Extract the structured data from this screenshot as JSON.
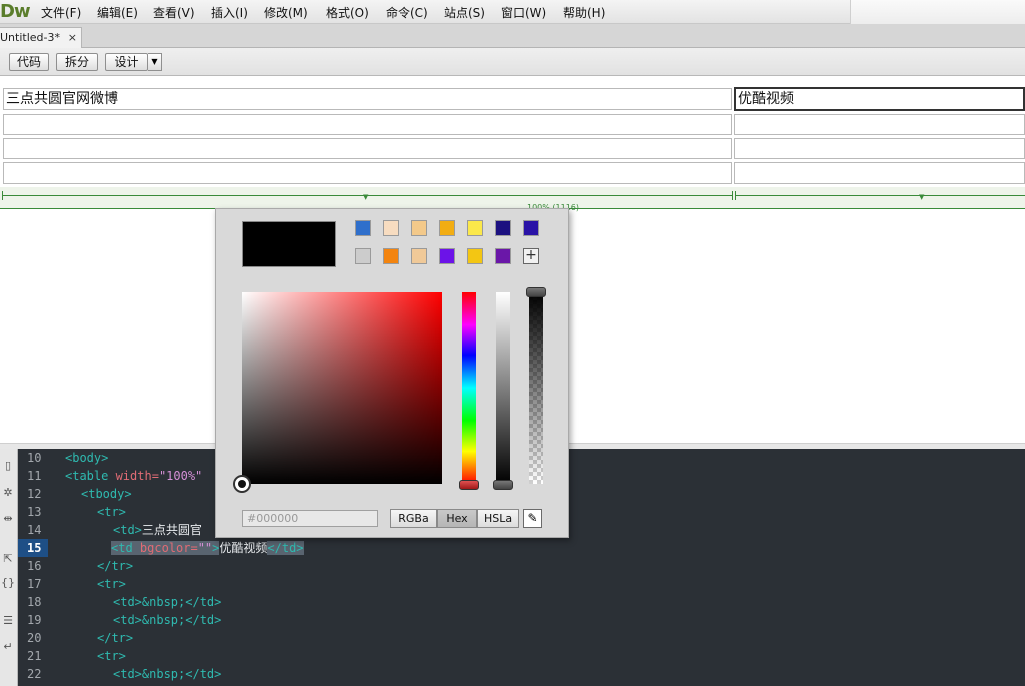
{
  "app": {
    "logo": "Dw"
  },
  "menu": [
    {
      "label": "文件(F)"
    },
    {
      "label": "编辑(E)"
    },
    {
      "label": "查看(V)"
    },
    {
      "label": "插入(I)"
    },
    {
      "label": "修改(M)"
    },
    {
      "label": "格式(O)"
    },
    {
      "label": "命令(C)"
    },
    {
      "label": "站点(S)"
    },
    {
      "label": "窗口(W)"
    },
    {
      "label": "帮助(H)"
    }
  ],
  "tab": {
    "title": "Untitled-3*",
    "close": "×"
  },
  "view_buttons": {
    "code": "代码",
    "split": "拆分",
    "design": "设计",
    "dropdown": "▼"
  },
  "design_table": {
    "cells": [
      [
        "三点共圆官网微博",
        "优酷视频"
      ],
      [
        "",
        ""
      ],
      [
        "",
        ""
      ],
      [
        "",
        ""
      ]
    ],
    "width_label": "100% (1116)"
  },
  "color_picker": {
    "current_color": "#000000",
    "swatches_row1": [
      "#2f6fcb",
      "#f7dcc0",
      "#f3c98a",
      "#f2ad12",
      "#fbe84a",
      "#1c1180",
      "#2a13a6"
    ],
    "swatches_row2": [
      "#cccccc",
      "#f3840f",
      "#f0c998",
      "#6c13e8",
      "#f3c613",
      "#6a17a8"
    ],
    "add_swatch": "+",
    "hex_value": "#000000",
    "modes": [
      {
        "label": "RGBa"
      },
      {
        "label": "Hex"
      },
      {
        "label": "HSLa"
      }
    ],
    "active_mode": "Hex",
    "eyedropper": "✎"
  },
  "code": {
    "lines": [
      {
        "num": "10",
        "current": false
      },
      {
        "num": "11",
        "current": false
      },
      {
        "num": "12",
        "current": false
      },
      {
        "num": "13",
        "current": false
      },
      {
        "num": "14",
        "current": false
      },
      {
        "num": "15",
        "current": true
      },
      {
        "num": "16",
        "current": false
      },
      {
        "num": "17",
        "current": false
      },
      {
        "num": "18",
        "current": false
      },
      {
        "num": "19",
        "current": false
      },
      {
        "num": "20",
        "current": false
      },
      {
        "num": "21",
        "current": false
      },
      {
        "num": "22",
        "current": false
      }
    ],
    "l10": "<body>",
    "l11_tag": "<table ",
    "l11_attr": "width=",
    "l11_val": "\"100%\"",
    "l12": "<tbody>",
    "l13": "<tr>",
    "l14_tag": "<td>",
    "l14_text": "三点共圆官",
    "l15_open": "<td ",
    "l15_attr": "bgcolor=",
    "l15_val": "\"\"",
    "l15_close": ">",
    "l15_text": "优酷视频",
    "l15_end": "</td>",
    "l16": "</tr>",
    "l17": "<tr>",
    "l18": "<td>&nbsp;</td>",
    "l19": "<td>&nbsp;</td>",
    "l20": "</tr>",
    "l21": "<tr>",
    "l22": "<td>&nbsp;</td>"
  }
}
